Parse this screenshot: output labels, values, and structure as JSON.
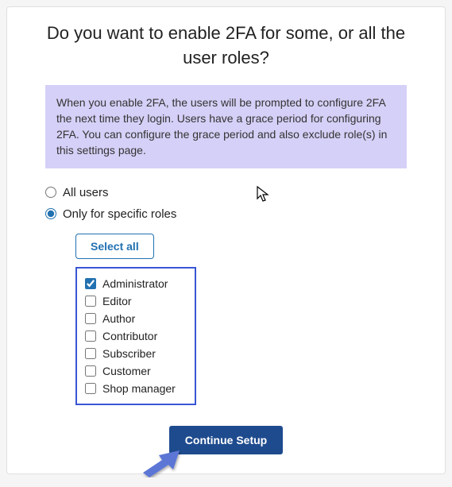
{
  "title": "Do you want to enable 2FA for some, or all the user roles?",
  "info": "When you enable 2FA, the users will be prompted to configure 2FA the next time they login. Users have a grace period for configuring 2FA. You can configure the grace period and also exclude role(s) in this settings page.",
  "options": {
    "all_users": "All users",
    "specific_roles": "Only for specific roles",
    "selected": "specific_roles"
  },
  "select_all_label": "Select all",
  "roles": [
    {
      "label": "Administrator",
      "checked": true
    },
    {
      "label": "Editor",
      "checked": false
    },
    {
      "label": "Author",
      "checked": false
    },
    {
      "label": "Contributor",
      "checked": false
    },
    {
      "label": "Subscriber",
      "checked": false
    },
    {
      "label": "Customer",
      "checked": false
    },
    {
      "label": "Shop manager",
      "checked": false
    }
  ],
  "continue_label": "Continue Setup"
}
